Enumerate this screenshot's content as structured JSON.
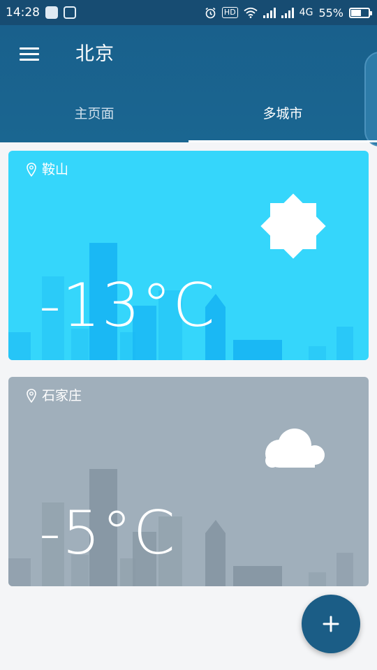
{
  "status_bar": {
    "time": "14:28",
    "hd_label": "HD",
    "network_label": "4G",
    "battery_percent_text": "55%",
    "battery_level": 0.55
  },
  "app_bar": {
    "title": "北京",
    "tabs": [
      {
        "label": "主页面",
        "active": false
      },
      {
        "label": "多城市",
        "active": true
      }
    ]
  },
  "cities": [
    {
      "city": "鞍山",
      "temperature": "-13°C",
      "weather_icon": "sun-icon",
      "card_color": "#35d6fb",
      "skyline_color": "#1ab8f4"
    },
    {
      "city": "石家庄",
      "temperature": "-5°C",
      "weather_icon": "cloud-icon",
      "card_color": "#a0afbb",
      "skyline_color": "#8898a5"
    }
  ],
  "fab": {
    "label": "+",
    "icon": "plus-icon",
    "color": "#1b5d86"
  },
  "colors": {
    "status_bar": "#174c72",
    "app_bar": "#19608c",
    "background": "#f4f5f7"
  }
}
